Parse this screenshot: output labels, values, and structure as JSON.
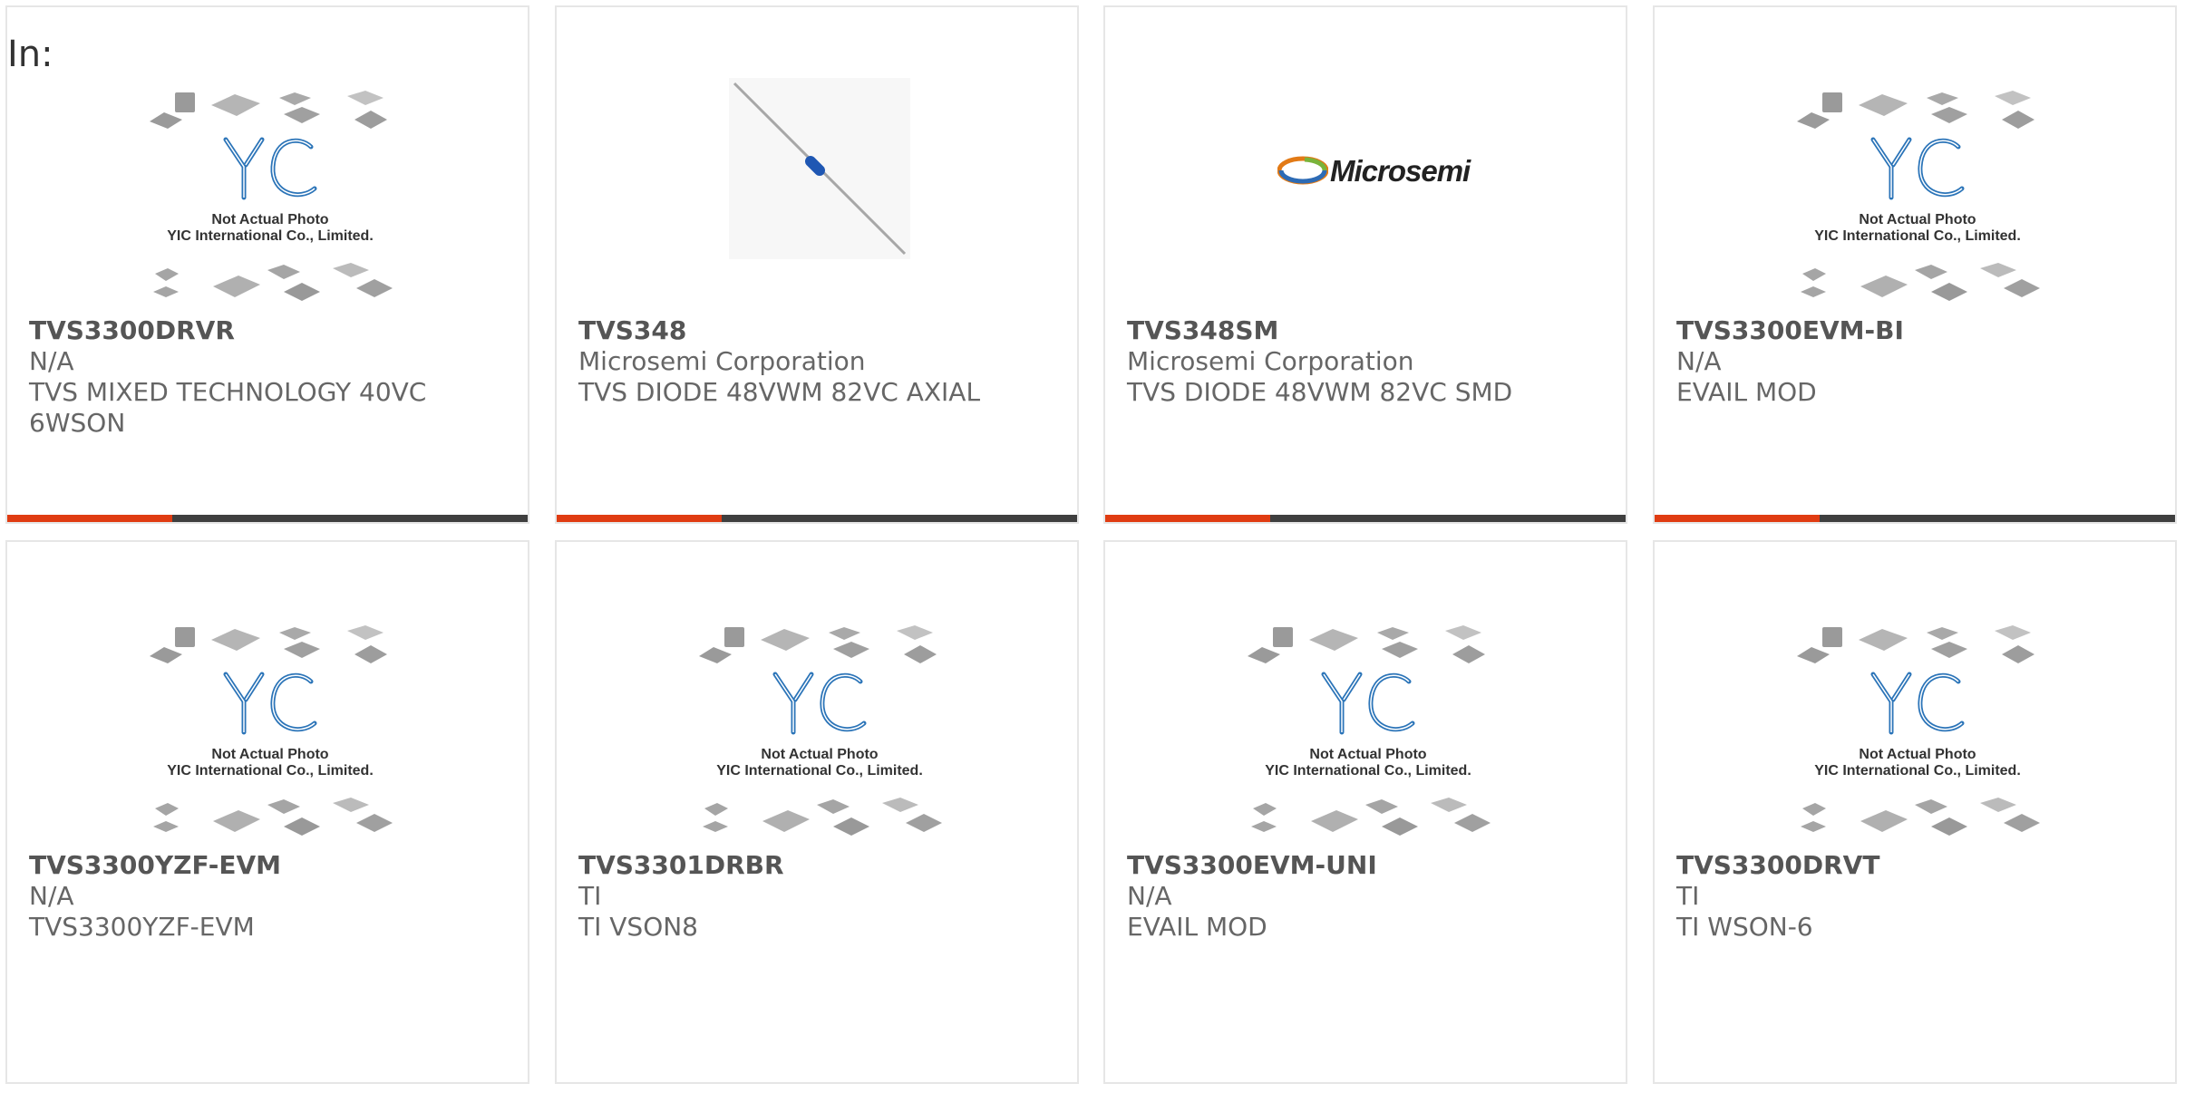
{
  "header": {
    "in_label": "In:"
  },
  "placeholder": {
    "line1": "Not Actual Photo",
    "line2": "YIC International Co., Limited."
  },
  "brand_logo_text": "Microsemi",
  "colors": {
    "accent": "#e03c12",
    "bar": "#3f3f3f",
    "border": "#e6e6e6"
  },
  "products": [
    {
      "part_number": "TVS3300DRVR",
      "manufacturer": "N/A",
      "description": "TVS MIXED TECHNOLOGY 40VC 6WSON",
      "image": "placeholder"
    },
    {
      "part_number": "TVS348",
      "manufacturer": "Microsemi Corporation",
      "description": "TVS DIODE 48VWM 82VC AXIAL",
      "image": "diode-photo"
    },
    {
      "part_number": "TVS348SM",
      "manufacturer": "Microsemi Corporation",
      "description": "TVS DIODE 48VWM 82VC SMD",
      "image": "microsemi-logo"
    },
    {
      "part_number": "TVS3300EVM-BI",
      "manufacturer": "N/A",
      "description": "EVAIL MOD",
      "image": "placeholder"
    },
    {
      "part_number": "TVS3300YZF-EVM",
      "manufacturer": "N/A",
      "description": "TVS3300YZF-EVM",
      "image": "placeholder"
    },
    {
      "part_number": "TVS3301DRBR",
      "manufacturer": "TI",
      "description": "TI VSON8",
      "image": "placeholder"
    },
    {
      "part_number": "TVS3300EVM-UNI",
      "manufacturer": "N/A",
      "description": "EVAIL MOD",
      "image": "placeholder"
    },
    {
      "part_number": "TVS3300DRVT",
      "manufacturer": "TI",
      "description": "TI WSON-6",
      "image": "placeholder"
    }
  ]
}
